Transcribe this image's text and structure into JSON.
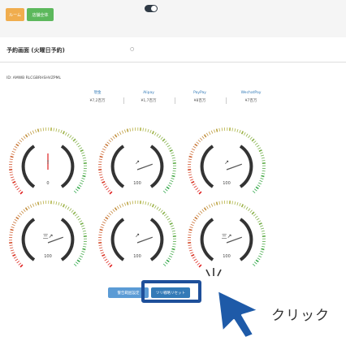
{
  "topbar": {
    "btn1_label": "ルーム",
    "btn2_label": "店舗全体"
  },
  "title": "予約画面 (火曜日予約)",
  "title_dot": "○",
  "device_line": "ID: AMWB RLCGBRHSHVZPML",
  "stats": [
    {
      "label": "現金",
      "value": "¥7,2百万"
    },
    {
      "label": "Alipay",
      "value": "¥1,7百万"
    },
    {
      "label": "PayPay",
      "value": "¥8百万"
    },
    {
      "label": "WechatPay",
      "value": "¥7百万"
    }
  ],
  "gauges": [
    {
      "label": "!",
      "value": "0",
      "caption": ""
    },
    {
      "label": "↗",
      "value": "100",
      "caption": ""
    },
    {
      "label": "↗",
      "value": "100",
      "caption": ""
    },
    {
      "label": "三↗",
      "value": "100",
      "caption": ""
    },
    {
      "label": "↗",
      "value": "100",
      "caption": ""
    },
    {
      "label": "三↗",
      "value": "100",
      "caption": ""
    }
  ],
  "bottom": {
    "btn1_label": "警告範囲設定",
    "btn2_label": "ツリ戦略リセット"
  },
  "annotation": {
    "text": "クリック"
  },
  "colors": {
    "accent": "#1e4f9a",
    "gauge_red": "#e02020",
    "gauge_green": "#2ea84b"
  }
}
